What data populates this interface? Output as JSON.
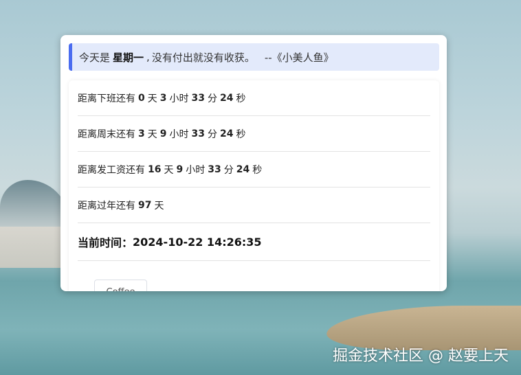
{
  "quote": {
    "prefix": "今天是",
    "weekday": "星期一",
    "sep": ",",
    "text": "没有付出就没有收获。",
    "source": "--《小美人鱼》"
  },
  "countdowns": [
    {
      "label": "距离下班还有",
      "parts": [
        [
          "0",
          "天"
        ],
        [
          "3",
          "小时"
        ],
        [
          "33",
          "分"
        ],
        [
          "24",
          "秒"
        ]
      ]
    },
    {
      "label": "距离周末还有",
      "parts": [
        [
          "3",
          "天"
        ],
        [
          "9",
          "小时"
        ],
        [
          "33",
          "分"
        ],
        [
          "24",
          "秒"
        ]
      ]
    },
    {
      "label": "距离发工资还有",
      "parts": [
        [
          "16",
          "天"
        ],
        [
          "9",
          "小时"
        ],
        [
          "33",
          "分"
        ],
        [
          "24",
          "秒"
        ]
      ]
    },
    {
      "label": "距离过年还有",
      "parts": [
        [
          "97",
          "天"
        ]
      ]
    }
  ],
  "current_time": {
    "label": "当前时间：",
    "value": "2024-10-22 14:26:35"
  },
  "button_label": "Coffee",
  "watermark": "掘金技术社区 @ 赵要上天",
  "colors": {
    "accent": "#4a6cf0",
    "quote_bg": "#e3eafb"
  }
}
